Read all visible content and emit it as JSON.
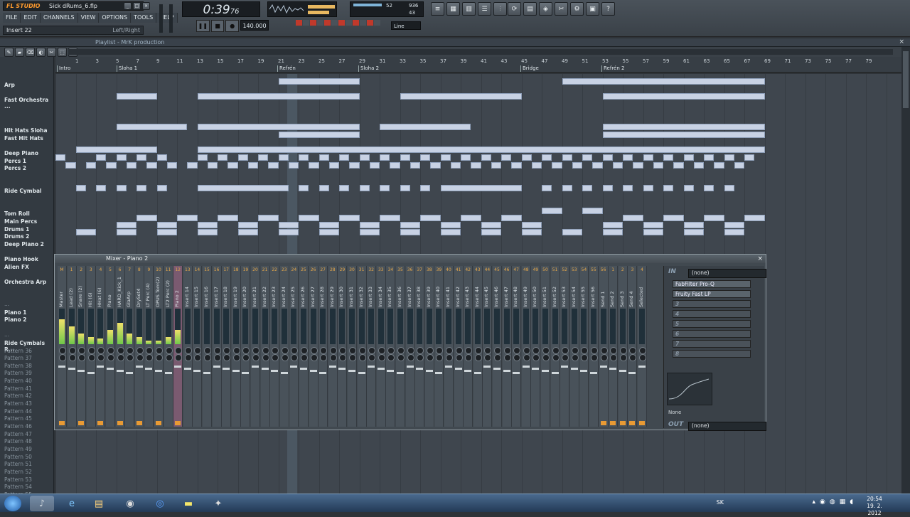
{
  "window": {
    "logo": "FL STUDIO",
    "file": "Sick dRums_6.flp",
    "menu": [
      "FILE",
      "EDIT",
      "CHANNELS",
      "VIEW",
      "OPTIONS",
      "TOOLS",
      "HELP"
    ],
    "insert": "Insert 22",
    "insert_mode": "Left/Right",
    "time": "0:39",
    "time_frac": "76",
    "tempo": "140.000",
    "snap": "Line",
    "cpu_val1": "52",
    "cpu_val2": "936",
    "cpu_val3": "43"
  },
  "playlist": {
    "title": "Playlist - MrK production",
    "markers": [
      "Intro",
      "Sloha 1",
      "Refrén",
      "Sloha 2",
      "Bridge",
      "Refrén 2"
    ],
    "ruler_ticks": [
      "1",
      "3",
      "5",
      "7",
      "9",
      "11",
      "13",
      "15",
      "17",
      "19",
      "21",
      "23",
      "25",
      "27",
      "29",
      "31",
      "33",
      "35",
      "37",
      "39",
      "41",
      "43",
      "45",
      "47",
      "49",
      "51",
      "53",
      "55",
      "57",
      "59",
      "61",
      "63",
      "65",
      "67",
      "69",
      "71",
      "73",
      "75",
      "77",
      "79"
    ],
    "tracks": [
      {
        "name": "Arp",
        "dim": false
      },
      {
        "name": "Fast Orchestra ...",
        "dim": false
      },
      {
        "name": "Hit Hats Sloha",
        "dim": false
      },
      {
        "name": "Fast Hit Hats",
        "dim": false
      },
      {
        "name": "Deep Piano",
        "dim": false
      },
      {
        "name": "Percs 1",
        "dim": false
      },
      {
        "name": "Percs 2",
        "dim": false
      },
      {
        "name": "Ride Cymbal",
        "dim": false
      },
      {
        "name": "Tom Roll",
        "dim": false
      },
      {
        "name": "Main Percs",
        "dim": false
      },
      {
        "name": "Drums 1",
        "dim": false
      },
      {
        "name": "Drums 2",
        "dim": false
      },
      {
        "name": "Deep Piano 2",
        "dim": false
      },
      {
        "name": "Piano Hook",
        "dim": false
      },
      {
        "name": "Alien FX",
        "dim": false
      },
      {
        "name": "Orchestra Arp",
        "dim": false
      },
      {
        "name": "...",
        "dim": true
      },
      {
        "name": "Piano 1",
        "dim": false
      },
      {
        "name": "Piano 2",
        "dim": false
      },
      {
        "name": "...",
        "dim": true
      },
      {
        "name": "Ride Cymbals R...",
        "dim": false
      },
      {
        "name": "Pattern 36",
        "dim": true
      },
      {
        "name": "Pattern 37",
        "dim": true
      },
      {
        "name": "Pattern 38",
        "dim": true
      },
      {
        "name": "Pattern 39",
        "dim": true
      },
      {
        "name": "Pattern 40",
        "dim": true
      },
      {
        "name": "Pattern 41",
        "dim": true
      },
      {
        "name": "Pattern 42",
        "dim": true
      },
      {
        "name": "Pattern 43",
        "dim": true
      },
      {
        "name": "Pattern 44",
        "dim": true
      },
      {
        "name": "Pattern 45",
        "dim": true
      },
      {
        "name": "Pattern 46",
        "dim": true
      },
      {
        "name": "Pattern 47",
        "dim": true
      },
      {
        "name": "Pattern 48",
        "dim": true
      },
      {
        "name": "Pattern 49",
        "dim": true
      },
      {
        "name": "Pattern 50",
        "dim": true
      },
      {
        "name": "Pattern 51",
        "dim": true
      },
      {
        "name": "Pattern 52",
        "dim": true
      },
      {
        "name": "Pattern 53",
        "dim": true
      },
      {
        "name": "Pattern 54",
        "dim": true
      },
      {
        "name": "Pattern 55",
        "dim": true
      }
    ]
  },
  "mixer": {
    "title": "Mixer - Piano 2",
    "strips": [
      "Master",
      "Lead (2)",
      "Snare (2)",
      "Hit (6)",
      "HHat (6)",
      "Piano",
      "HARD_Kick_1",
      "GlaArp",
      "DrySet4",
      "LT Perc (4)",
      "OPUS Tom(2)",
      "LT2 Perc (2)",
      "Piano 2",
      "Insert 14",
      "Insert 15",
      "Insert 16",
      "Insert 17",
      "Insert 18",
      "Insert 19",
      "Insert 20",
      "Insert 21",
      "Insert 22",
      "Insert 23",
      "Insert 24",
      "Insert 25",
      "Insert 26",
      "Insert 27",
      "Insert 28",
      "Insert 29",
      "Insert 30",
      "Insert 31",
      "Insert 32",
      "Insert 33",
      "Insert 34",
      "Insert 35",
      "Insert 36",
      "Insert 37",
      "Insert 38",
      "Insert 39",
      "Insert 40",
      "Insert 41",
      "Insert 42",
      "Insert 43",
      "Insert 44",
      "Insert 45",
      "Insert 46",
      "Insert 47",
      "Insert 48",
      "Insert 49",
      "Insert 50",
      "Insert 51",
      "Insert 52",
      "Insert 53",
      "Insert 54",
      "Insert 55",
      "Insert 56",
      "Send 1",
      "Send 2",
      "Send 3",
      "Send 4",
      "Selected"
    ],
    "strip_nums": [
      "M",
      "1",
      "2",
      "3",
      "4",
      "5",
      "6",
      "7",
      "8",
      "9",
      "10",
      "11",
      "12",
      "13",
      "14",
      "15",
      "16",
      "17",
      "18",
      "19",
      "20",
      "21",
      "22",
      "23",
      "24",
      "25",
      "26",
      "27",
      "28",
      "29",
      "30",
      "31",
      "32",
      "33",
      "34",
      "35",
      "36",
      "37",
      "38",
      "39",
      "40",
      "41",
      "42",
      "43",
      "44",
      "45",
      "46",
      "47",
      "48",
      "49",
      "50",
      "51",
      "52",
      "53",
      "54",
      "55",
      "56",
      "1",
      "2",
      "3",
      "4",
      "C"
    ],
    "in_label": "IN",
    "in_value": "(none)",
    "out_label": "OUT",
    "out_value": "(none)",
    "fx_slots": [
      "FabFilter Pro-Q",
      "Fruity Fast LP",
      "3",
      "4",
      "5",
      "6",
      "7",
      "8"
    ],
    "eq_mode": "None"
  },
  "taskbar": {
    "lang": "SK",
    "time": "20:54",
    "date": "19. 2. 2012"
  }
}
